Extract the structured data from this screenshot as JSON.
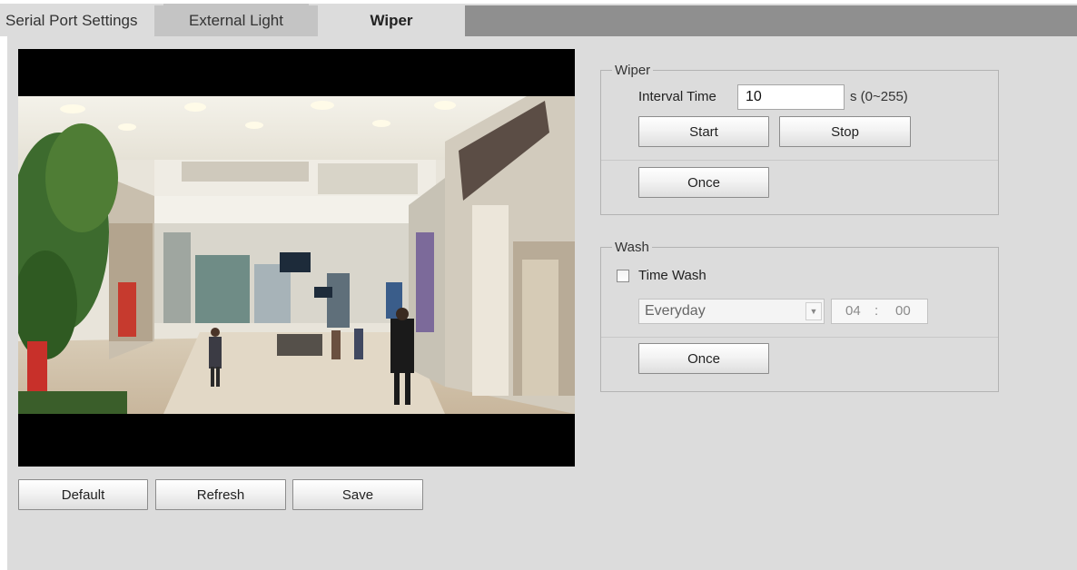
{
  "tabs": {
    "serial_port": "Serial Port Settings",
    "external_light": "External Light",
    "wiper": "Wiper"
  },
  "wiper": {
    "legend": "Wiper",
    "interval_label": "Interval Time",
    "interval_value": "10",
    "interval_unit": "s (0~255)",
    "start_label": "Start",
    "stop_label": "Stop",
    "once_label": "Once"
  },
  "wash": {
    "legend": "Wash",
    "time_wash_label": "Time Wash",
    "time_wash_checked": false,
    "schedule_selected": "Everyday",
    "time_hour": "04",
    "time_separator": ":",
    "time_minute": "00",
    "once_label": "Once"
  },
  "footer": {
    "default_label": "Default",
    "refresh_label": "Refresh",
    "save_label": "Save"
  },
  "colors": {
    "panel_bg": "#dcdcdc",
    "tab_strip": "#8f8f8f",
    "inactive_tab": "#c4c4c4"
  }
}
